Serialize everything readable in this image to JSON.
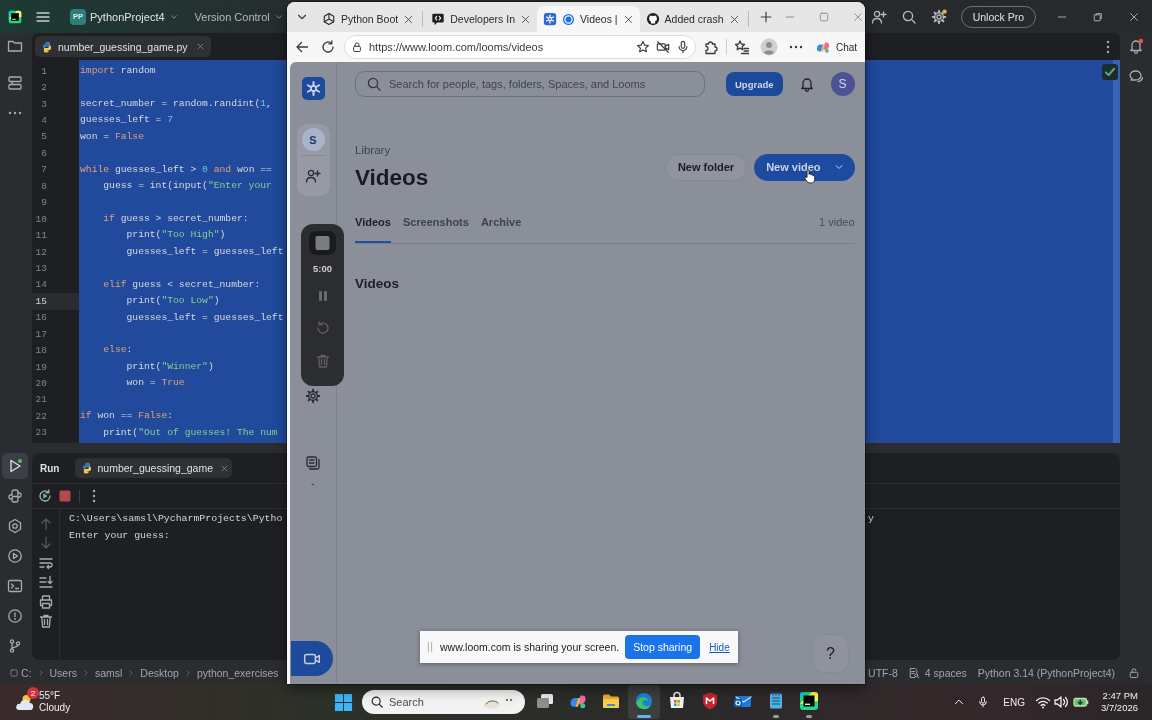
{
  "ide": {
    "title_bar": {
      "project_badge": "PP",
      "project": "PythonProject4",
      "vcs_menu": "Version Control",
      "unlock_button": "Unlock Pro"
    },
    "tool_buttons": [
      {
        "selected": false
      },
      {
        "selected": false
      },
      {
        "selected": false
      },
      {
        "selected": true
      },
      {
        "selected": false
      },
      {
        "selected": false
      },
      {
        "selected": false
      },
      {
        "selected": false
      },
      {
        "selected": false
      },
      {
        "selected": false
      }
    ],
    "editor_tab": "number_guessing_game.py",
    "editor": {
      "selected": true,
      "lines": [
        {
          "number": "1",
          "current": false,
          "tokens": [
            {
              "kind": "keyword",
              "text": "import"
            },
            {
              "kind": "plain",
              "text": " random"
            }
          ]
        },
        {
          "number": "2",
          "current": false
        },
        {
          "number": "3",
          "current": false,
          "tokens": [
            {
              "kind": "plain",
              "text": "secret_number = random.randint("
            },
            {
              "kind": "number",
              "text": "1"
            },
            {
              "kind": "plain",
              "text": ","
            }
          ]
        },
        {
          "number": "4",
          "current": false,
          "tokens": [
            {
              "kind": "plain",
              "text": "guesses_left = "
            },
            {
              "kind": "number",
              "text": "7"
            }
          ]
        },
        {
          "number": "5",
          "current": false,
          "tokens": [
            {
              "kind": "plain",
              "text": "won = "
            },
            {
              "kind": "keyword",
              "text": "False"
            }
          ]
        },
        {
          "number": "6",
          "current": false
        },
        {
          "number": "7",
          "current": false,
          "tokens": [
            {
              "kind": "keyword",
              "text": "while"
            },
            {
              "kind": "plain",
              "text": " guesses_left > "
            },
            {
              "kind": "number",
              "text": "0"
            },
            {
              "kind": "keyword",
              "text": " and"
            },
            {
              "kind": "plain",
              "text": " won =="
            }
          ]
        },
        {
          "number": "8",
          "current": false,
          "tokens": [
            {
              "kind": "plain",
              "text": "    guess = int(input("
            },
            {
              "kind": "string",
              "text": "\"Enter your"
            }
          ]
        },
        {
          "number": "9",
          "current": false
        },
        {
          "number": "10",
          "current": false,
          "tokens": [
            {
              "kind": "keyword",
              "text": "    if"
            },
            {
              "kind": "plain",
              "text": " guess > secret_number:"
            }
          ]
        },
        {
          "number": "11",
          "current": false,
          "tokens": [
            {
              "kind": "plain",
              "text": "        print("
            },
            {
              "kind": "string",
              "text": "\"Too High\""
            },
            {
              "kind": "plain",
              "text": ")"
            }
          ]
        },
        {
          "number": "12",
          "current": false,
          "tokens": [
            {
              "kind": "plain",
              "text": "        guesses_left = guesses_left"
            }
          ]
        },
        {
          "number": "13",
          "current": false
        },
        {
          "number": "14",
          "current": false,
          "tokens": [
            {
              "kind": "keyword",
              "text": "    elif"
            },
            {
              "kind": "plain",
              "text": " guess < secret_number:"
            }
          ]
        },
        {
          "number": "15",
          "current": true,
          "tokens": [
            {
              "kind": "plain",
              "text": "        print("
            },
            {
              "kind": "string",
              "text": "\"Too Low\""
            },
            {
              "kind": "plain",
              "text": ")"
            }
          ]
        },
        {
          "number": "16",
          "current": false,
          "tokens": [
            {
              "kind": "plain",
              "text": "        guesses_left = guesses_left"
            }
          ]
        },
        {
          "number": "17",
          "current": false
        },
        {
          "number": "18",
          "current": false,
          "tokens": [
            {
              "kind": "keyword",
              "text": "    else"
            },
            {
              "kind": "plain",
              "text": ":"
            }
          ]
        },
        {
          "number": "19",
          "current": false,
          "tokens": [
            {
              "kind": "plain",
              "text": "        print("
            },
            {
              "kind": "string",
              "text": "\"Winner\""
            },
            {
              "kind": "plain",
              "text": ")"
            }
          ]
        },
        {
          "number": "20",
          "current": false,
          "tokens": [
            {
              "kind": "plain",
              "text": "        won = "
            },
            {
              "kind": "keyword",
              "text": "True"
            }
          ]
        },
        {
          "number": "21",
          "current": false
        },
        {
          "number": "22",
          "current": false,
          "tokens": [
            {
              "kind": "keyword",
              "text": "if"
            },
            {
              "kind": "plain",
              "text": " won == "
            },
            {
              "kind": "keyword",
              "text": "False"
            },
            {
              "kind": "plain",
              "text": ":"
            }
          ]
        },
        {
          "number": "23",
          "current": false,
          "tokens": [
            {
              "kind": "plain",
              "text": "    print("
            },
            {
              "kind": "string",
              "text": "\"Out of guesses! The num"
            }
          ]
        }
      ]
    },
    "run_panel": {
      "title": "Run",
      "tab": "number_guessing_game",
      "console": [
        "C:\\Users\\samsl\\PycharmProjects\\Pytho",
        "Enter your guess:"
      ],
      "console_tail": "y"
    },
    "status_bar": {
      "path": [
        "C:",
        "Users",
        "samsl",
        "Desktop",
        "python_exercises"
      ],
      "encoding": "UTF-8",
      "indent": "4 spaces",
      "interpreter": "Python 3.14 (PythonProject4)"
    }
  },
  "browser": {
    "tabs": [
      {
        "title": "Python Boot",
        "selected": false
      },
      {
        "title": "Developers In",
        "selected": false
      },
      {
        "title": "Videos |",
        "selected": true
      },
      {
        "title": "Added crash",
        "selected": false
      }
    ],
    "url": "https://www.loom.com/looms/videos",
    "copilot_button": "Chat",
    "page": {
      "search_placeholder": "Search for people, tags, folders, Spaces, and Looms",
      "upgrade_button": "Upgrade",
      "account_initial": "S",
      "sidebar": {
        "workspace_initial": "S",
        "caption": "-"
      },
      "recorder": {
        "time": "5:00"
      },
      "breadcrumb": "Library",
      "title": "Videos",
      "buttons": [
        {
          "label": "New folder",
          "kind": "secondary"
        },
        {
          "label": "New video",
          "kind": "primary"
        }
      ],
      "tabs": [
        {
          "label": "Videos",
          "selected": true
        },
        {
          "label": "Screenshots",
          "selected": false
        },
        {
          "label": "Archive",
          "selected": false
        }
      ],
      "count": "1 video",
      "section_title": "Videos",
      "help_button": "?"
    }
  },
  "share_bar": {
    "message": "www.loom.com is sharing your screen.",
    "stop_button": "Stop sharing",
    "hide_link": "Hide"
  },
  "taskbar": {
    "weather": {
      "badge": "2",
      "temperature": "55°F",
      "condition": "Cloudy"
    },
    "search_placeholder": "Search",
    "apps": [
      {
        "running": false,
        "active": false
      },
      {
        "running": false,
        "active": false
      },
      {
        "running": false,
        "active": false
      },
      {
        "running": true,
        "active": true
      },
      {
        "running": false,
        "active": false
      },
      {
        "running": false,
        "active": false
      },
      {
        "running": false,
        "active": false
      },
      {
        "running": true,
        "active": false
      },
      {
        "running": true,
        "active": false
      }
    ],
    "language": "ENG",
    "time": "2:47 PM",
    "date": "3/7/2026"
  }
}
